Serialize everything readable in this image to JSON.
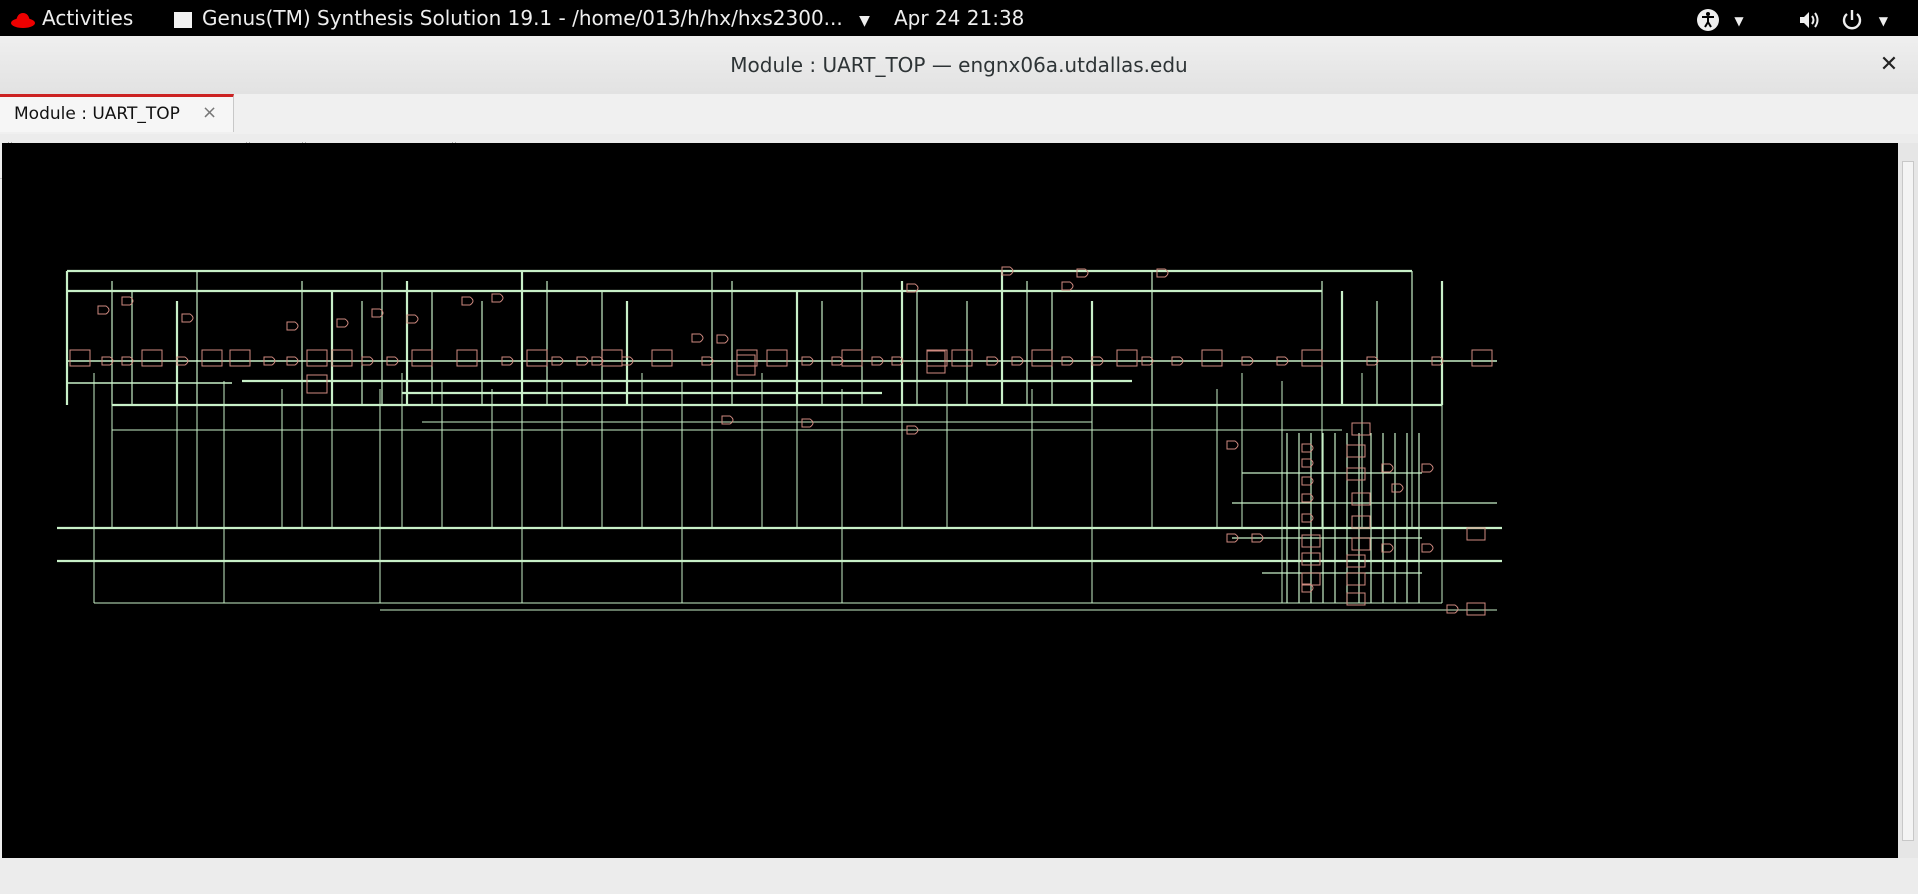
{
  "topbar": {
    "activities": "Activities",
    "app_title": "Genus(TM) Synthesis Solution 19.1 - /home/013/h/hx/hxs2300...",
    "clock": "Apr 24  21:38"
  },
  "window": {
    "title": "Module : UART_TOP — engnx06a.utdallas.edu",
    "close_glyph": "✕"
  },
  "tab": {
    "label": "Module : UART_TOP",
    "close_glyph": "×"
  },
  "toolbar": {
    "icons": [
      "zoom-in-icon",
      "zoom-out-icon",
      "zoom-fit-icon",
      "refresh-icon",
      "stop-icon",
      "go-up-icon",
      "back-icon",
      "forward-icon",
      "hierarchy-icon",
      "properties-icon",
      "settings-icon"
    ]
  },
  "schematic": {
    "module": "UART_TOP",
    "background": "#000000",
    "wire_color": "#c8f0c8",
    "cell_color": "#d08a80"
  }
}
